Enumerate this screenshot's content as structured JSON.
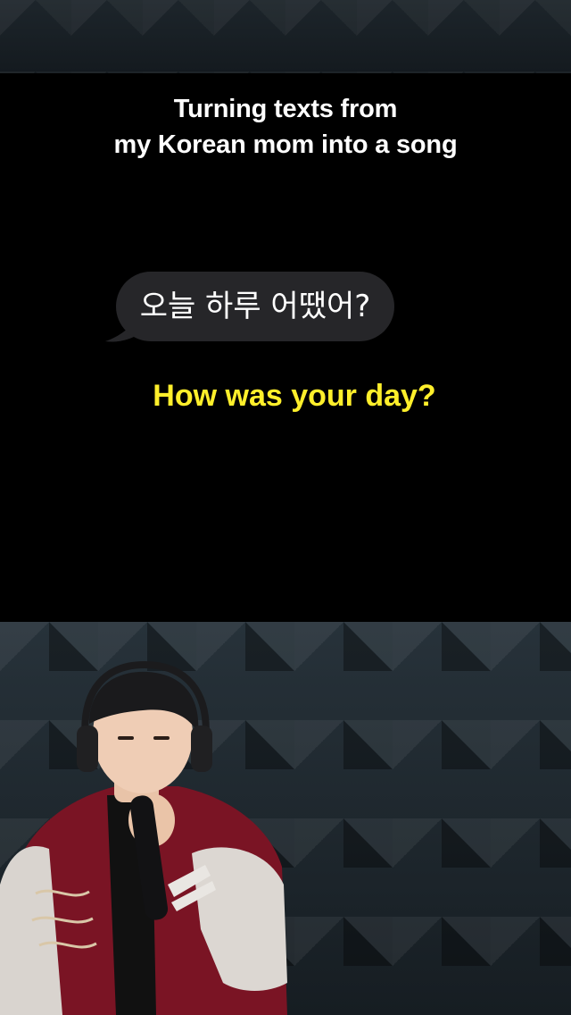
{
  "caption": {
    "line1": "Turning texts from",
    "line2": "my Korean mom into a song"
  },
  "message": {
    "korean": "오늘 하루 어땠어?",
    "bubble_color": "#262629"
  },
  "translation": {
    "text": "How was your day?",
    "color": "#ffef2b"
  },
  "scene": {
    "performer": "singer-with-headphones-and-microphone"
  }
}
